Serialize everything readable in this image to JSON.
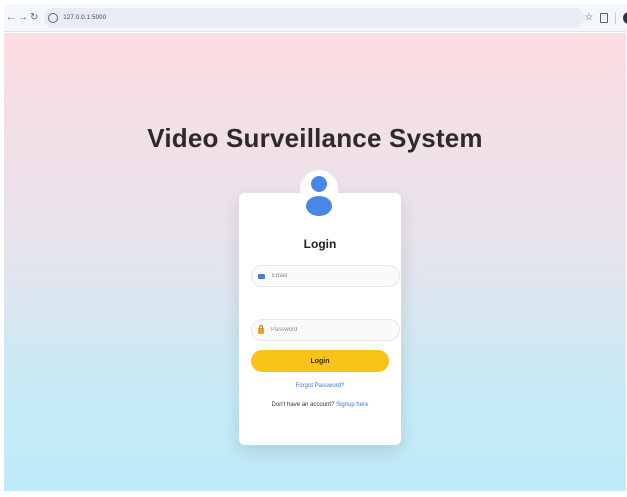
{
  "browser": {
    "url": "127.0.0.1:5000",
    "icons": [
      "back-arrow-icon",
      "forward-arrow-icon",
      "reload-icon",
      "site-info-icon",
      "star-icon",
      "extensions-icon",
      "profile-icon"
    ]
  },
  "page": {
    "title": "Video Surveillance System",
    "gradient_colors": [
      "#fcdde3",
      "#bfeaf8"
    ]
  },
  "login_card": {
    "heading": "Login",
    "email_placeholder": "Email",
    "password_placeholder": "Password",
    "login_button_label": "Login",
    "forgot_password_link": "Forgot Password?",
    "no_account_text": "Don't have an account?",
    "signup_link": "Signup here",
    "accent_color": "#f7c318",
    "link_color": "#3a7ad6"
  }
}
